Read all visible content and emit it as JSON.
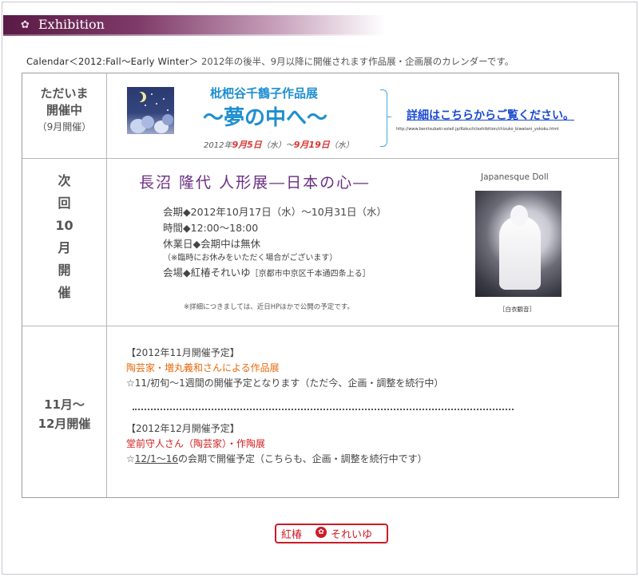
{
  "header": {
    "title": "Exhibition",
    "icon": "flower-icon",
    "gradient_colors": [
      "#5a1a46",
      "#c8a2bc",
      "#ffffff"
    ]
  },
  "calendar": {
    "label": "Calendar＜2012:Fall～Early Winter＞",
    "description": "2012年の後半、9月以降に開催されます作品展・企画展のカレンダーです。"
  },
  "current": {
    "label_line1": "ただいま",
    "label_line2": "開催中",
    "label_line3": "（9月開催）",
    "title": "枇杷谷千鶴子作品展",
    "subtitle": "～夢の中へ～",
    "date_prefix": "2012年",
    "date_start": "9月5日",
    "date_start_dow": "（水）～",
    "date_end": "9月19日",
    "date_end_dow": "（水）",
    "detail_link": "詳細はこちらからご覧ください。",
    "detail_url": "http://www.benitsubaki-soleil.jp/Kokuchi/exhibition/chizuko_biwatani_yokoku.html",
    "accent_color": "#1f8fd0"
  },
  "next": {
    "label_chars": [
      "次",
      "回",
      "10",
      "月",
      "開",
      "催"
    ],
    "title": "長沼 隆代 人形展―日本の心―",
    "period": "会期◆2012年10月17日（水）～10月31日（水）",
    "hours": "時間◆12:00～18:00",
    "closed": "休業日◆会期中は無休",
    "closed_note": "（※臨時にお休みをいただく場合がございます）",
    "venue": "会場◆紅椿それいゆ",
    "venue_address": "［京都市中京区千本通四条上る］",
    "note": "※詳細につきましては、近日HPほかで公開の予定です。",
    "photo_label": "Japanesque Doll",
    "photo_caption": "［白衣観音］",
    "title_color": "#6a2d84"
  },
  "future": {
    "label_line1": "11月～",
    "label_line2": "12月開催",
    "nov_heading": "【2012年11月開催予定】",
    "nov_title": "陶芸家・増丸義和さんによる作品展",
    "nov_desc": "☆11/初旬～1週間の開催予定となります（ただ今、企画・調整を続行中）",
    "dec_heading": "【2012年12月開催予定】",
    "dec_title": "堂前守人さん（陶芸家）・作陶展",
    "dec_desc_prefix": "☆",
    "dec_desc_date": "12/1～16",
    "dec_desc_rest": "の会期で開催予定（こちらも、企画・調整を続行中です）",
    "nov_color": "#e8690c",
    "dec_color": "#d21e1e"
  },
  "footer": {
    "logo_text1": "紅椿",
    "logo_text2": "それいゆ",
    "logo_icon": "camellia-icon",
    "logo_color": "#cc1c28"
  }
}
